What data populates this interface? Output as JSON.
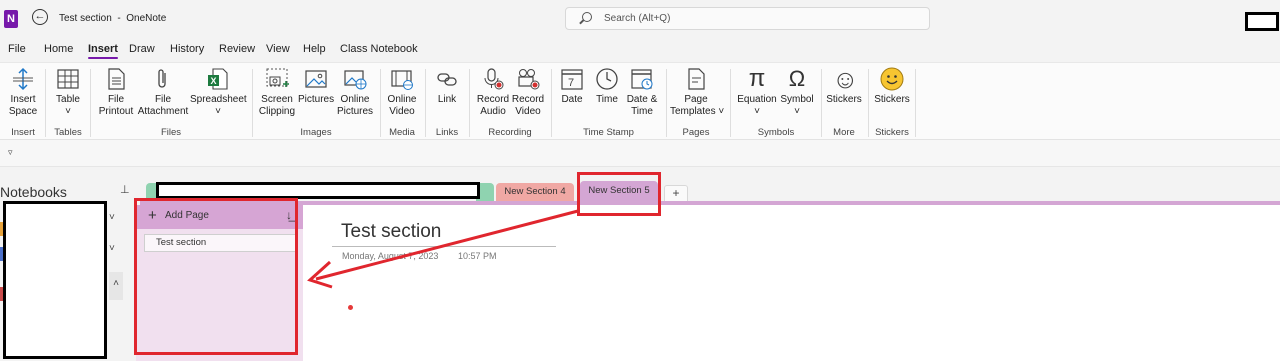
{
  "window": {
    "title": "Test section  -  OneNote",
    "logo_letter": "N",
    "back_glyph": "←",
    "search_placeholder": "Search (Alt+Q)"
  },
  "menu": [
    "File",
    "Home",
    "Insert",
    "Draw",
    "History",
    "Review",
    "View",
    "Help",
    "Class Notebook"
  ],
  "menu_active": "Insert",
  "ribbon": {
    "buttons": [
      {
        "id": "insert-space",
        "label": "Insert\nSpace",
        "icon": "insert-space-icon"
      },
      {
        "id": "table",
        "label": "Table\n˅",
        "icon": "table-icon"
      },
      {
        "id": "file-printout",
        "label": "File\nPrintout",
        "icon": "file-printout-icon"
      },
      {
        "id": "file-attachment",
        "label": "File\nAttachment",
        "icon": "paperclip-icon"
      },
      {
        "id": "spreadsheet",
        "label": "Spreadsheet\n˅",
        "icon": "spreadsheet-icon"
      },
      {
        "id": "screen-clipping",
        "label": "Screen\nClipping",
        "icon": "screen-clipping-icon"
      },
      {
        "id": "pictures",
        "label": "Pictures",
        "icon": "picture-icon"
      },
      {
        "id": "online-pictures",
        "label": "Online\nPictures",
        "icon": "online-pictures-icon"
      },
      {
        "id": "online-video",
        "label": "Online\nVideo",
        "icon": "online-video-icon"
      },
      {
        "id": "link",
        "label": "Link",
        "icon": "link-icon"
      },
      {
        "id": "record-audio",
        "label": "Record\nAudio",
        "icon": "record-audio-icon"
      },
      {
        "id": "record-video",
        "label": "Record\nVideo",
        "icon": "record-video-icon"
      },
      {
        "id": "date",
        "label": "Date",
        "icon": "calendar-icon"
      },
      {
        "id": "time",
        "label": "Time",
        "icon": "clock-icon"
      },
      {
        "id": "date-time",
        "label": "Date &\nTime",
        "icon": "calendar-clock-icon"
      },
      {
        "id": "page-templates",
        "label": "Page\nTemplates ˅",
        "icon": "page-templates-icon"
      },
      {
        "id": "equation",
        "label": "Equation\n˅",
        "icon": "pi-icon"
      },
      {
        "id": "symbol",
        "label": "Symbol\n˅",
        "icon": "omega-icon"
      },
      {
        "id": "stickers-more",
        "label": "Stickers",
        "icon": "smiley-outline-icon"
      },
      {
        "id": "stickers",
        "label": "Stickers",
        "icon": "smiley-sticker-icon"
      }
    ],
    "groups": [
      "Insert",
      "Tables",
      "Files",
      "Images",
      "Media",
      "Links",
      "Recording",
      "Time Stamp",
      "Pages",
      "Symbols",
      "More",
      "Stickers"
    ],
    "glyphs": {
      "pi": "π",
      "omega": "Ω",
      "smile": "☺"
    }
  },
  "qat_glyph": "▿",
  "navigation": {
    "label": "Notebooks",
    "pin_glyph": "⊥",
    "chevron_down": "˅",
    "chevron_up": "˄"
  },
  "sections": {
    "tabs": [
      {
        "label": "New Section 4",
        "color": "#f0a8a4"
      },
      {
        "label": "New Section 5",
        "color": "#d4a6d4",
        "active": true
      }
    ],
    "add_glyph": "+"
  },
  "pages": {
    "add_label": "Add Page",
    "add_glyph": "+",
    "sort_glyph": "↓̲",
    "items": [
      "Test section"
    ]
  },
  "page": {
    "title": "Test section",
    "date": "Monday, August 7, 2023",
    "time": "10:57 PM"
  },
  "colors": {
    "accent": "#7719aa",
    "section5": "#d4a6d4",
    "annotation": "#e0262e"
  }
}
